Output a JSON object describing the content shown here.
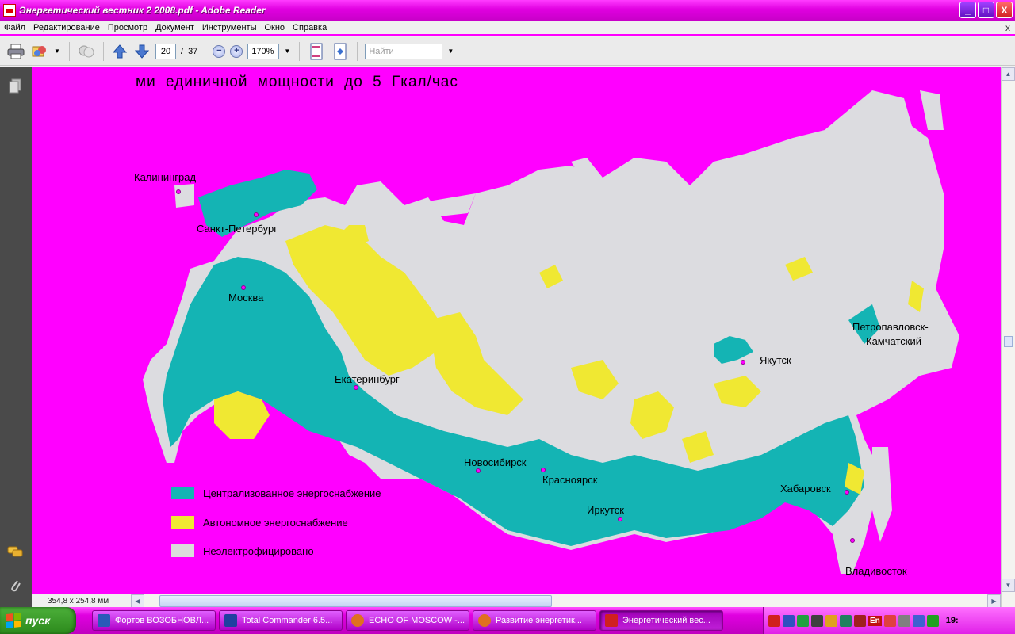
{
  "window": {
    "title": "Энергетический вестник 2 2008.pdf - Adobe Reader",
    "controls": [
      "_",
      "□",
      "X"
    ]
  },
  "menu": {
    "items": [
      "Файл",
      "Редактирование",
      "Просмотр",
      "Документ",
      "Инструменты",
      "Окно",
      "Справка"
    ],
    "close": "x"
  },
  "toolbar": {
    "page_current": "20",
    "page_separator": "/",
    "page_total": "37",
    "zoom": "170%",
    "search_placeholder": "Найти"
  },
  "document": {
    "heading": "ми единичной мощности до 5 Гкал/час",
    "cities": [
      {
        "name": "Калининград"
      },
      {
        "name": "Санкт-Петербург"
      },
      {
        "name": "Москва"
      },
      {
        "name": "Екатеринбург"
      },
      {
        "name": "Новосибирск"
      },
      {
        "name": "Красноярск"
      },
      {
        "name": "Иркутск"
      },
      {
        "name": "Якутск"
      },
      {
        "name": "Петропавловск-"
      },
      {
        "name": "Камчатский"
      },
      {
        "name": "Хабаровск"
      },
      {
        "name": "Владивосток"
      }
    ],
    "legend": [
      {
        "label": "Централизованное энергоснабжение",
        "color": "#14b4b4"
      },
      {
        "label": "Автономное энергоснабжение",
        "color": "#f0e832"
      },
      {
        "label": "Неэлектрофицировано",
        "color": "#dcdcdc"
      }
    ],
    "background_color": "#ff00ff"
  },
  "status": {
    "page_size": "354,8 x 254,8 мм"
  },
  "taskbar": {
    "start_label": "пуск",
    "tasks": [
      {
        "label": "Фортов ВОЗОБНОВЛ..."
      },
      {
        "label": "Total Commander 6.5..."
      },
      {
        "label": "ECHO OF MOSCOW -..."
      },
      {
        "label": "Развитие энергетик..."
      },
      {
        "label": "Энергетический вес..."
      }
    ],
    "tray_lang": "En",
    "clock": "19:"
  }
}
